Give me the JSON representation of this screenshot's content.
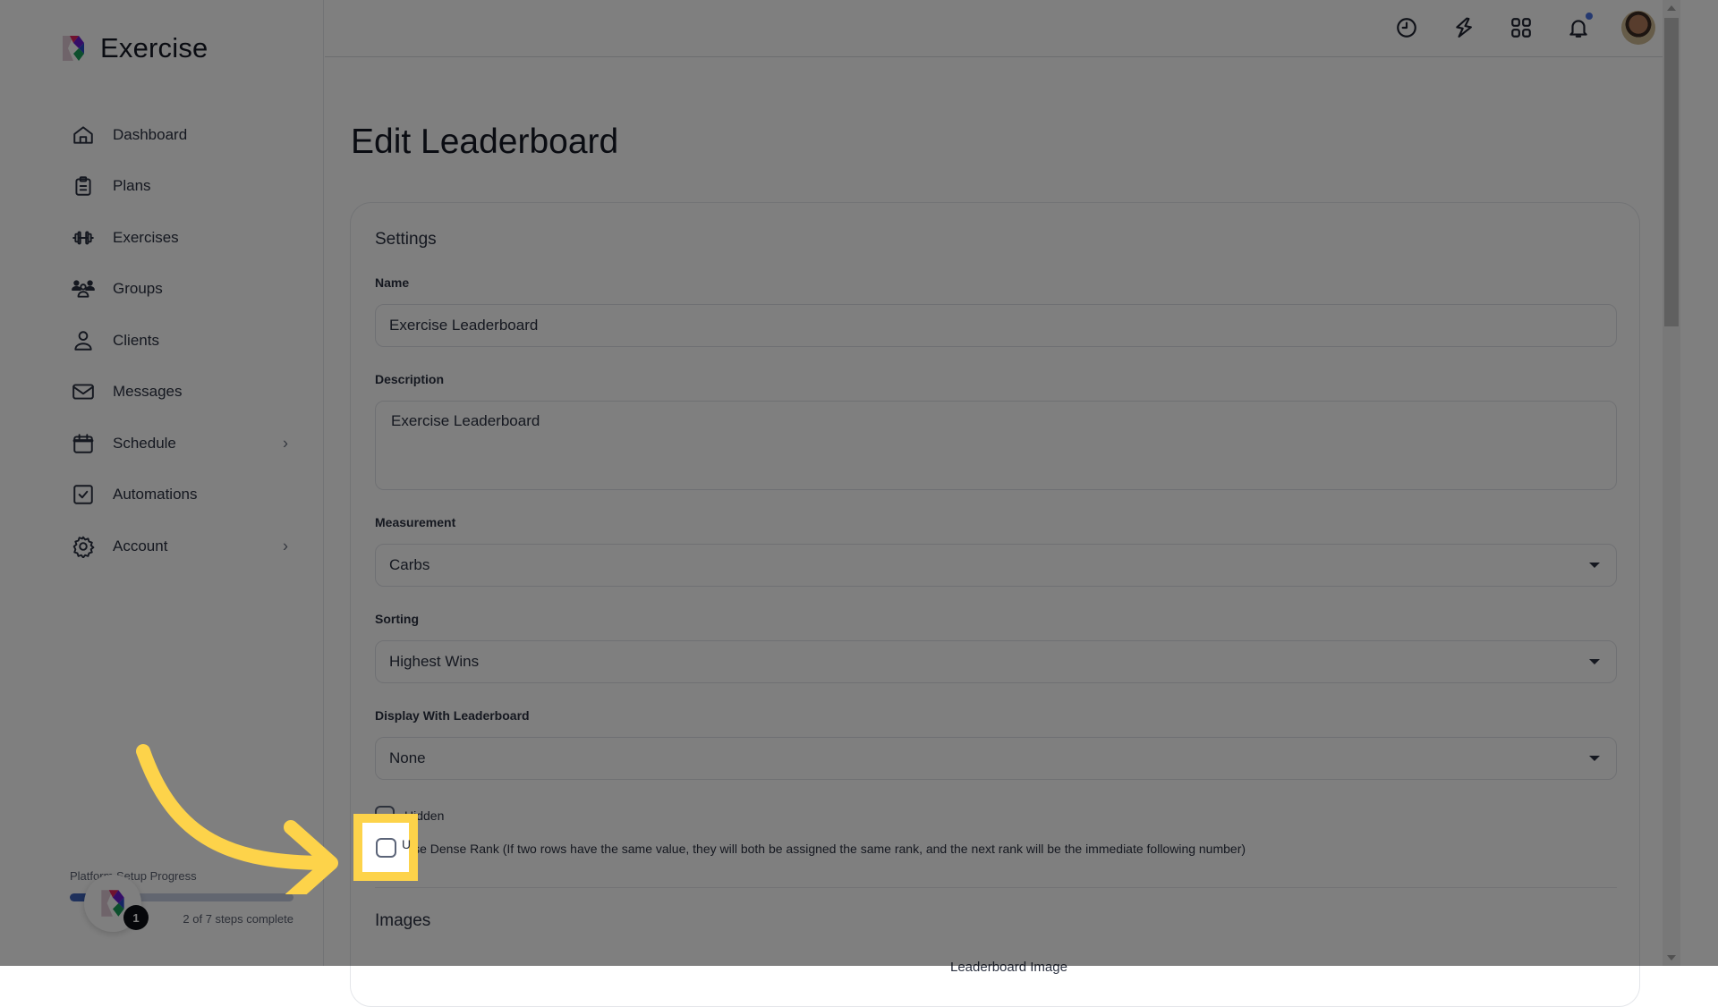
{
  "app": {
    "name": "Exercise",
    "brand_colors": [
      "#e0245e",
      "#6a1bd1",
      "#1a9e5a"
    ]
  },
  "sidebar": {
    "items": [
      {
        "label": "Dashboard",
        "icon": "home-icon",
        "has_submenu": false
      },
      {
        "label": "Plans",
        "icon": "clipboard-icon",
        "has_submenu": false
      },
      {
        "label": "Exercises",
        "icon": "dumbbell-icon",
        "has_submenu": false
      },
      {
        "label": "Groups",
        "icon": "users-icon",
        "has_submenu": false
      },
      {
        "label": "Clients",
        "icon": "user-icon",
        "has_submenu": false
      },
      {
        "label": "Messages",
        "icon": "mail-icon",
        "has_submenu": false
      },
      {
        "label": "Schedule",
        "icon": "calendar-icon",
        "has_submenu": true
      },
      {
        "label": "Automations",
        "icon": "checkbox-icon",
        "has_submenu": false
      },
      {
        "label": "Account",
        "icon": "gear-icon",
        "has_submenu": true
      }
    ],
    "chevron": "›",
    "setup_progress": {
      "title": "Platform Setup Progress",
      "completed": 2,
      "total": 7,
      "fraction": 0.2857,
      "text": "2 of 7 steps complete",
      "badge": "1",
      "fill_color": "#3e63b8"
    }
  },
  "topbar": {
    "icons": [
      "clock-icon",
      "lightning-icon",
      "grid-icon",
      "bell-icon"
    ],
    "notification_dot_color": "#4a72e0"
  },
  "main": {
    "title": "Edit Leaderboard",
    "settings": {
      "heading": "Settings",
      "name": {
        "label": "Name",
        "value": "Exercise Leaderboard"
      },
      "description": {
        "label": "Description",
        "value": "Exercise Leaderboard"
      },
      "measurement": {
        "label": "Measurement",
        "value": "Carbs"
      },
      "sorting": {
        "label": "Sorting",
        "value": "Highest Wins"
      },
      "display_with": {
        "label": "Display With Leaderboard",
        "value": "None"
      },
      "hidden": {
        "label": "Hidden",
        "checked": false
      },
      "dense_rank": {
        "label": "Use Dense Rank (If two rows have the same value, they will both be assigned the same rank, and the next rank will be the immediate following number)",
        "checked": false
      }
    },
    "images": {
      "heading": "Images",
      "leaderboard_image_label": "Leaderboard Image"
    }
  },
  "annotation": {
    "highlight_color": "#fdd34a",
    "target": "dense-rank-checkbox",
    "visible_label_fragment": "U"
  }
}
